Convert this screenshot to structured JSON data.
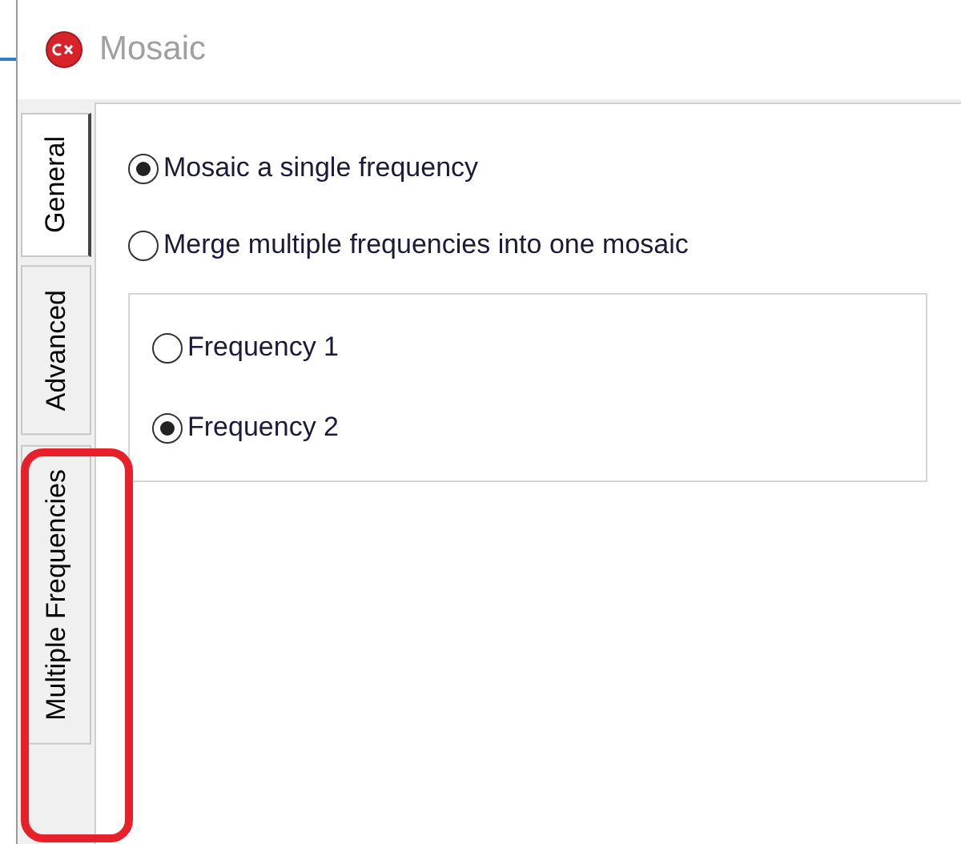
{
  "window": {
    "title": "Mosaic"
  },
  "tabs": [
    {
      "label": "General",
      "selected": true
    },
    {
      "label": "Advanced",
      "selected": false
    },
    {
      "label": "Multiple Frequencies",
      "selected": false
    }
  ],
  "mode_options": [
    {
      "label": "Mosaic a single frequency",
      "selected": true
    },
    {
      "label": "Merge multiple frequencies into one mosaic",
      "selected": false
    }
  ],
  "frequency_group": {
    "options": [
      {
        "label": "Frequency 1",
        "selected": false
      },
      {
        "label": "Frequency 2",
        "selected": true
      }
    ]
  }
}
